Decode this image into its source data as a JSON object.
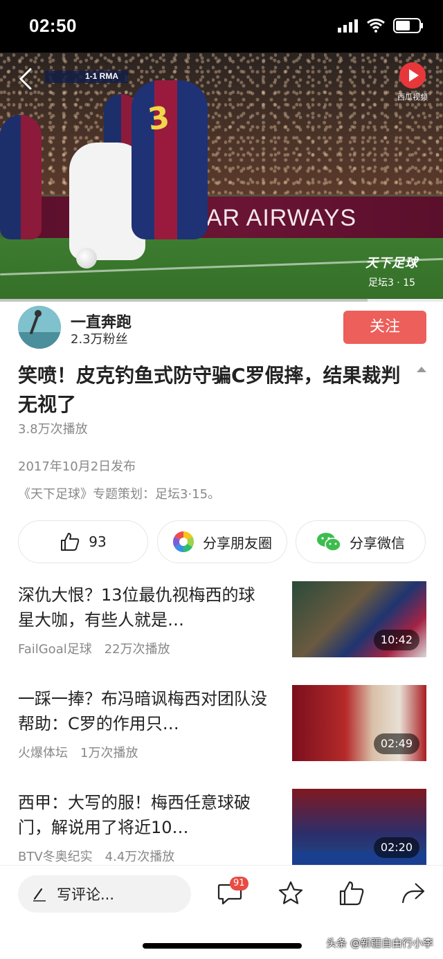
{
  "status_bar": {
    "time": "02:50"
  },
  "video": {
    "scoreboard": "1-1 RMA",
    "jersey_number": "3",
    "ad_board": "QATAR AIRWAYS",
    "channel_logo_label": "西瓜视频",
    "watermark_title": "天下足球",
    "watermark_subtitle": "足坛3 · 15",
    "progress_fraction": 0.49,
    "buffered_fraction": 0.83
  },
  "author": {
    "name": "一直奔跑",
    "fans": "2.3万粉丝",
    "follow_label": "关注"
  },
  "article": {
    "title": "笑喷！皮克钓鱼式防守骗C罗假摔，结果裁判无视了",
    "plays": "3.8万次播放",
    "publish_date": "2017年10月2日发布",
    "description": "《天下足球》专题策划：足坛3·15。"
  },
  "actions": {
    "like_count": "93",
    "share_moments": "分享朋友圈",
    "share_wechat": "分享微信"
  },
  "related": [
    {
      "title": "深仇大恨？13位最仇视梅西的球星大咖，有些人就是…",
      "source": "FailGoal足球",
      "plays": "22万次播放",
      "duration": "10:42"
    },
    {
      "title": "一踩一捧？布冯暗讽梅西对团队没帮助：C罗的作用只…",
      "source": "火爆体坛",
      "plays": "1万次播放",
      "duration": "02:49"
    },
    {
      "title": "西甲：大写的服！梅西任意球破门，解说用了将近10…",
      "source": "BTV冬奥纪实",
      "plays": "4.4万次播放",
      "duration": "02:20"
    }
  ],
  "bottom_bar": {
    "comment_placeholder": "写评论...",
    "comment_count": "91"
  },
  "watermark": "头条 @新疆自由行小李",
  "colors": {
    "accent": "#ec5f5a",
    "progress": "#e94b42"
  }
}
